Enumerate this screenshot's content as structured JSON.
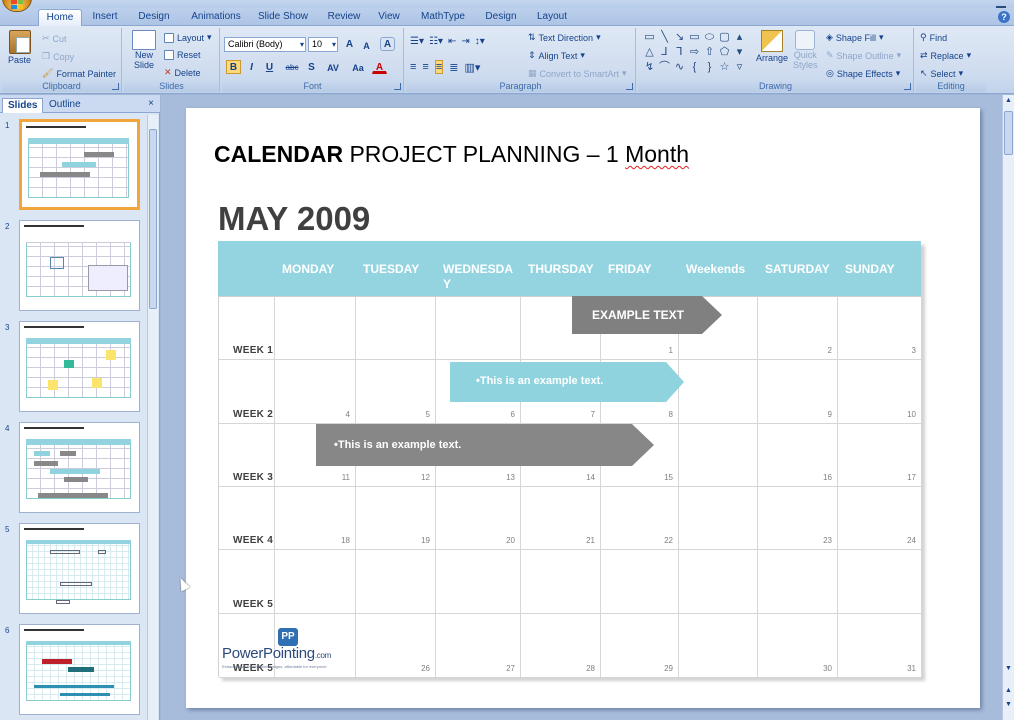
{
  "ribbon_tabs": [
    "Home",
    "Insert",
    "Design",
    "Animations",
    "Slide Show",
    "Review",
    "View",
    "MathType",
    "Design",
    "Layout"
  ],
  "clipboard": {
    "paste": "Paste",
    "cut": "Cut",
    "copy": "Copy",
    "format_painter": "Format Painter",
    "title": "Clipboard"
  },
  "slides_group": {
    "new_slide_1": "New",
    "new_slide_2": "Slide",
    "layout": "Layout",
    "reset": "Reset",
    "delete": "Delete",
    "title": "Slides"
  },
  "font_group": {
    "font_name": "Calibri (Body)",
    "font_size": "10",
    "grow": "A",
    "shrink": "A",
    "clear": "A",
    "bold": "B",
    "italic": "I",
    "underline": "U",
    "strike": "abc",
    "shadow": "S",
    "spacing": "AV",
    "case": "Aa",
    "color": "A",
    "title": "Font"
  },
  "paragraph_group": {
    "text_direction": "Text Direction",
    "align_text": "Align Text",
    "smartart": "Convert to SmartArt",
    "title": "Paragraph"
  },
  "drawing_group": {
    "arrange": "Arrange",
    "quick_styles_1": "Quick",
    "quick_styles_2": "Styles",
    "shape_fill": "Shape Fill",
    "shape_outline": "Shape Outline",
    "shape_effects": "Shape Effects",
    "title": "Drawing"
  },
  "editing_group": {
    "find": "Find",
    "replace": "Replace",
    "select": "Select",
    "title": "Editing"
  },
  "panel": {
    "tab_slides": "Slides",
    "tab_outline": "Outline",
    "close": "×",
    "slide_numbers": [
      "1",
      "2",
      "3",
      "4",
      "5",
      "6"
    ]
  },
  "slide": {
    "title_bold": "CALENDAR",
    "title_rest": "PROJECT PLANNING – 1",
    "title_month_word": "Month",
    "month_label": "MAY 2009",
    "days": [
      "MONDAY",
      "TUESDAY",
      "WEDNESDAY",
      "THURSDAY",
      "FRIDAY",
      "Weekends",
      "SATURDAY",
      "SUNDAY"
    ],
    "weeks": [
      "WEEK 1",
      "WEEK 2",
      "WEEK 3",
      "WEEK 4",
      "WEEK 5",
      "WEEK 5"
    ],
    "dates": [
      [
        "",
        "",
        "",
        "",
        "1",
        "",
        "2",
        "3"
      ],
      [
        "4",
        "5",
        "6",
        "7",
        "8",
        "",
        "9",
        "10"
      ],
      [
        "11",
        "12",
        "13",
        "14",
        "15",
        "",
        "16",
        "17"
      ],
      [
        "18",
        "19",
        "20",
        "21",
        "22",
        "",
        "23",
        "24"
      ],
      [
        "",
        "",
        "",
        "",
        "",
        "",
        "",
        ""
      ],
      [
        "",
        "26",
        "27",
        "28",
        "29",
        "",
        "30",
        "31"
      ]
    ],
    "bar1": "EXAMPLE TEXT",
    "bar2": "•This is an example text.",
    "bar3": "•This is an example text.",
    "brand_badge": "PP",
    "brand_name": "PowerPointing",
    "brand_domain": ".com",
    "brand_tagline": "Extraordinary PowerPoint designs, affordable for everyone!"
  },
  "colors": {
    "header_teal": "#93d4e0",
    "bar_gray": "#808080",
    "bar_cyan": "#8fd3df",
    "ribbon_blue": "#dfe9f5"
  }
}
